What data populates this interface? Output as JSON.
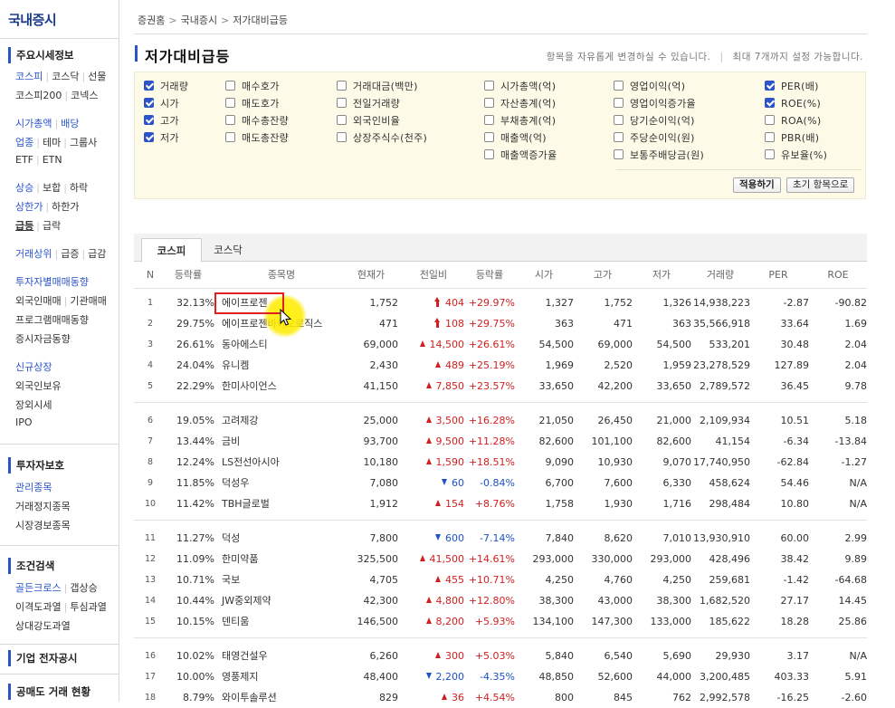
{
  "sidebar": {
    "brand": "국내증시",
    "market_title": "주요시세정보",
    "links": {
      "kospi": "코스피",
      "kosdaq": "코스닥",
      "futures": "선물",
      "kospi200": "코스피200",
      "konex": "코넥스",
      "market_cap": "시가총액",
      "dividend": "배당",
      "industry": "업종",
      "theme": "테마",
      "group": "그룹사",
      "etf": "ETF",
      "etn": "ETN",
      "rise": "상승",
      "flat": "보합",
      "fall": "하락",
      "upper_limit": "상한가",
      "lower_limit": "하한가",
      "surge": "급등",
      "plunge": "급락",
      "volume_top": "거래상위",
      "vol_surge": "급증",
      "vol_drop": "급감",
      "investor": "투자자별매매동향",
      "foreign": "외국인매매",
      "institution": "기관매매",
      "program": "프로그램매매동향",
      "deposit": "증시자금동향",
      "new_listing": "신규상장",
      "foreign_hold": "외국인보유",
      "off_market": "장외시세",
      "ipo": "IPO"
    },
    "protect_title": "투자자보호",
    "protect": {
      "managed": "관리종목",
      "halted": "거래정지종목",
      "warning": "시장경보종목"
    },
    "cond_title": "조건검색",
    "cond": {
      "golden": "골든크로스",
      "gap_up": "갭상승",
      "disparity": "이격도과열",
      "psych": "투심과열",
      "rsi": "상대강도과열"
    },
    "disclosure_title": "기업 전자공시",
    "short_title": "공매도 거래 현황"
  },
  "breadcrumb": [
    "증권홈",
    "국내증시",
    "저가대비급등"
  ],
  "page_title": "저가대비급등",
  "hint": {
    "left": "항목을 자유롭게 변경하실 수 있습니다.",
    "right": "최대 7개까지 설정 가능합니다."
  },
  "options": {
    "col1": [
      {
        "label": "거래량",
        "checked": true
      },
      {
        "label": "시가",
        "checked": true
      },
      {
        "label": "고가",
        "checked": true
      },
      {
        "label": "저가",
        "checked": true
      }
    ],
    "col2": [
      {
        "label": "매수호가",
        "checked": false
      },
      {
        "label": "매도호가",
        "checked": false
      },
      {
        "label": "매수총잔량",
        "checked": false
      },
      {
        "label": "매도총잔량",
        "checked": false
      }
    ],
    "col3": [
      {
        "label": "거래대금(백만)",
        "checked": false
      },
      {
        "label": "전일거래량",
        "checked": false
      },
      {
        "label": "외국인비율",
        "checked": false
      },
      {
        "label": "상장주식수(천주)",
        "checked": false
      }
    ],
    "col4": [
      {
        "label": "시가총액(억)",
        "checked": false
      },
      {
        "label": "자산총계(억)",
        "checked": false
      },
      {
        "label": "부채총계(억)",
        "checked": false
      },
      {
        "label": "매출액(억)",
        "checked": false
      },
      {
        "label": "매출액증가율",
        "checked": false
      }
    ],
    "col5": [
      {
        "label": "영업이익(억)",
        "checked": false
      },
      {
        "label": "영업이익증가율",
        "checked": false
      },
      {
        "label": "당기순이익(억)",
        "checked": false
      },
      {
        "label": "주당순이익(원)",
        "checked": false
      },
      {
        "label": "보통주배당금(원)",
        "checked": false
      }
    ],
    "col6": [
      {
        "label": "PER(배)",
        "checked": true
      },
      {
        "label": "ROE(%)",
        "checked": true
      },
      {
        "label": "ROA(%)",
        "checked": false
      },
      {
        "label": "PBR(배)",
        "checked": false
      },
      {
        "label": "유보율(%)",
        "checked": false
      }
    ],
    "apply_label": "적용하기",
    "reset_label": "초기 항목으로"
  },
  "tabs": {
    "kospi": "코스피",
    "kosdaq": "코스닥"
  },
  "columns": [
    "N",
    "등락률",
    "종목명",
    "현재가",
    "전일비",
    "등락률",
    "시가",
    "고가",
    "저가",
    "거래량",
    "PER",
    "ROE"
  ],
  "rows": [
    {
      "n": "1",
      "rate_low": "32.13%",
      "name": "에이프로젠",
      "price": "1,752",
      "dir": "upper",
      "change": "404",
      "pct": "+29.97%",
      "open": "1,327",
      "high": "1,752",
      "low": "1,326",
      "volume": "14,938,223",
      "per": "-2.87",
      "roe": "-90.82"
    },
    {
      "n": "2",
      "rate_low": "29.75%",
      "name": "에이프로젠바이오로직스",
      "price": "471",
      "dir": "upper",
      "change": "108",
      "pct": "+29.75%",
      "open": "363",
      "high": "471",
      "low": "363",
      "volume": "35,566,918",
      "per": "33.64",
      "roe": "1.69"
    },
    {
      "n": "3",
      "rate_low": "26.61%",
      "name": "동아에스티",
      "price": "69,000",
      "dir": "up",
      "change": "14,500",
      "pct": "+26.61%",
      "open": "54,500",
      "high": "69,000",
      "low": "54,500",
      "volume": "533,201",
      "per": "30.48",
      "roe": "2.04"
    },
    {
      "n": "4",
      "rate_low": "24.04%",
      "name": "유니켐",
      "price": "2,430",
      "dir": "up",
      "change": "489",
      "pct": "+25.19%",
      "open": "1,969",
      "high": "2,520",
      "low": "1,959",
      "volume": "23,278,529",
      "per": "127.89",
      "roe": "2.04"
    },
    {
      "n": "5",
      "rate_low": "22.29%",
      "name": "한미사이언스",
      "price": "41,150",
      "dir": "up",
      "change": "7,850",
      "pct": "+23.57%",
      "open": "33,650",
      "high": "42,200",
      "low": "33,650",
      "volume": "2,789,572",
      "per": "36.45",
      "roe": "9.78"
    },
    {
      "n": "6",
      "rate_low": "19.05%",
      "name": "고려제강",
      "price": "25,000",
      "dir": "up",
      "change": "3,500",
      "pct": "+16.28%",
      "open": "21,050",
      "high": "26,450",
      "low": "21,000",
      "volume": "2,109,934",
      "per": "10.51",
      "roe": "5.18"
    },
    {
      "n": "7",
      "rate_low": "13.44%",
      "name": "금비",
      "price": "93,700",
      "dir": "up",
      "change": "9,500",
      "pct": "+11.28%",
      "open": "82,600",
      "high": "101,100",
      "low": "82,600",
      "volume": "41,154",
      "per": "-6.34",
      "roe": "-13.84"
    },
    {
      "n": "8",
      "rate_low": "12.24%",
      "name": "LS전선아시아",
      "price": "10,180",
      "dir": "up",
      "change": "1,590",
      "pct": "+18.51%",
      "open": "9,090",
      "high": "10,930",
      "low": "9,070",
      "volume": "17,740,950",
      "per": "-62.84",
      "roe": "-1.27"
    },
    {
      "n": "9",
      "rate_low": "11.85%",
      "name": "덕성우",
      "price": "7,080",
      "dir": "down",
      "change": "60",
      "pct": "-0.84%",
      "open": "6,700",
      "high": "7,600",
      "low": "6,330",
      "volume": "458,624",
      "per": "54.46",
      "roe": "N/A"
    },
    {
      "n": "10",
      "rate_low": "11.42%",
      "name": "TBH글로벌",
      "price": "1,912",
      "dir": "up",
      "change": "154",
      "pct": "+8.76%",
      "open": "1,758",
      "high": "1,930",
      "low": "1,716",
      "volume": "298,484",
      "per": "10.80",
      "roe": "N/A"
    },
    {
      "n": "11",
      "rate_low": "11.27%",
      "name": "덕성",
      "price": "7,800",
      "dir": "down",
      "change": "600",
      "pct": "-7.14%",
      "open": "7,840",
      "high": "8,620",
      "low": "7,010",
      "volume": "13,930,910",
      "per": "60.00",
      "roe": "2.99"
    },
    {
      "n": "12",
      "rate_low": "11.09%",
      "name": "한미약품",
      "price": "325,500",
      "dir": "up",
      "change": "41,500",
      "pct": "+14.61%",
      "open": "293,000",
      "high": "330,000",
      "low": "293,000",
      "volume": "428,496",
      "per": "38.42",
      "roe": "9.89"
    },
    {
      "n": "13",
      "rate_low": "10.71%",
      "name": "국보",
      "price": "4,705",
      "dir": "up",
      "change": "455",
      "pct": "+10.71%",
      "open": "4,250",
      "high": "4,760",
      "low": "4,250",
      "volume": "259,681",
      "per": "-1.42",
      "roe": "-64.68"
    },
    {
      "n": "14",
      "rate_low": "10.44%",
      "name": "JW중외제약",
      "price": "42,300",
      "dir": "up",
      "change": "4,800",
      "pct": "+12.80%",
      "open": "38,300",
      "high": "43,000",
      "low": "38,300",
      "volume": "1,682,520",
      "per": "27.17",
      "roe": "14.45"
    },
    {
      "n": "15",
      "rate_low": "10.15%",
      "name": "덴티움",
      "price": "146,500",
      "dir": "up",
      "change": "8,200",
      "pct": "+5.93%",
      "open": "134,100",
      "high": "147,300",
      "low": "133,000",
      "volume": "185,622",
      "per": "18.28",
      "roe": "25.86"
    },
    {
      "n": "16",
      "rate_low": "10.02%",
      "name": "태영건설우",
      "price": "6,260",
      "dir": "up",
      "change": "300",
      "pct": "+5.03%",
      "open": "5,840",
      "high": "6,540",
      "low": "5,690",
      "volume": "29,930",
      "per": "3.17",
      "roe": "N/A"
    },
    {
      "n": "17",
      "rate_low": "10.00%",
      "name": "영풍제지",
      "price": "48,400",
      "dir": "down",
      "change": "2,200",
      "pct": "-4.35%",
      "open": "48,850",
      "high": "52,600",
      "low": "44,000",
      "volume": "3,200,485",
      "per": "403.33",
      "roe": "5.91"
    },
    {
      "n": "18",
      "rate_low": "8.79%",
      "name": "와이투솔루션",
      "price": "829",
      "dir": "up",
      "change": "36",
      "pct": "+4.54%",
      "open": "800",
      "high": "845",
      "low": "762",
      "volume": "2,992,578",
      "per": "-16.25",
      "roe": "-2.60"
    }
  ],
  "colors": {
    "accent": "#2b54c9",
    "up": "#d11f1f",
    "down": "#1b52c8",
    "highlight": "#e02020",
    "cursor_glow": "#ffeb00"
  }
}
